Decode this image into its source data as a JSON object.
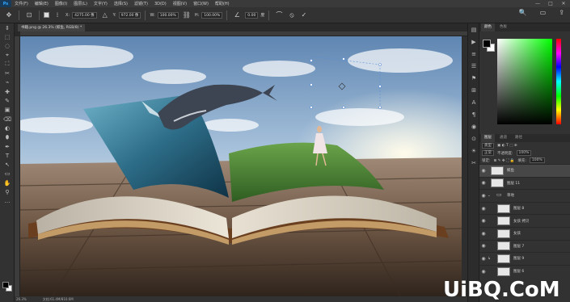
{
  "menubar": {
    "logo": "Ps",
    "items": [
      "文件(F)",
      "编辑(E)",
      "图像(I)",
      "图层(L)",
      "文字(Y)",
      "选择(S)",
      "滤镜(T)",
      "3D(D)",
      "视图(V)",
      "窗口(W)",
      "帮助(H)"
    ],
    "window_controls": [
      "—",
      "□",
      "✕"
    ]
  },
  "options": {
    "x_label": "X:",
    "x_value": "4275.00 像",
    "y_label": "Y:",
    "y_value": "972.00 像",
    "w_label": "W:",
    "w_value": "100.00%",
    "h_label": "H:",
    "h_value": "100.00%",
    "angle_value": "0.00",
    "interp_label": "度",
    "cancel_icon": "⦸",
    "commit_icon": "✓",
    "right_icons": [
      "🔍",
      "▭",
      "⇪"
    ]
  },
  "document": {
    "tab_label": "书籍.png @ 26.3% (鲸鱼, RGB/8) *",
    "status_zoom": "26.3%",
    "status_doc": "文档:61.4M/810.6M"
  },
  "tools": [
    "⇕",
    "⬚",
    "◌",
    "⌖",
    "⛶",
    "✂",
    "⌁",
    "✚",
    "✎",
    "▣",
    "⌫",
    "◐",
    "⬮",
    "✒",
    "T",
    "↖",
    "▭",
    "✋",
    "⚲",
    "…"
  ],
  "dock_icons": [
    "▤",
    "▶",
    "≡",
    "☰",
    "⚑",
    "⊞",
    "A",
    "¶",
    "◉",
    "⊙",
    "☀",
    "✂"
  ],
  "color_panel": {
    "tabs": [
      "颜色",
      "色板"
    ]
  },
  "layers_panel": {
    "tabs": [
      "图层",
      "通道",
      "路径"
    ],
    "kind_label": "类型",
    "blend_mode": "正常",
    "opacity_label": "不透明度:",
    "opacity_value": "100%",
    "lock_label": "锁定:",
    "fill_label": "填充:",
    "fill_value": "100%",
    "layers": [
      {
        "name": "鲸鱼",
        "type": "layer",
        "selected": true
      },
      {
        "name": "图层 11",
        "type": "layer",
        "selected": false
      },
      {
        "name": "草地",
        "type": "group",
        "selected": false
      },
      {
        "name": "图层 8",
        "type": "layer",
        "selected": false
      },
      {
        "name": "女孩 拷贝",
        "type": "layer",
        "selected": false
      },
      {
        "name": "女孩",
        "type": "layer",
        "selected": false
      },
      {
        "name": "图层 7",
        "type": "layer",
        "selected": false
      },
      {
        "name": "图层 9",
        "type": "layer",
        "selected": false
      },
      {
        "name": "图层 6",
        "type": "layer",
        "selected": false
      }
    ]
  },
  "watermark": "UiBQ.CoM",
  "colors": {
    "ui_dark": "#323232",
    "ui_darker": "#282828",
    "accent_blue": "#31a8ff",
    "selected_layer": "#474747"
  }
}
